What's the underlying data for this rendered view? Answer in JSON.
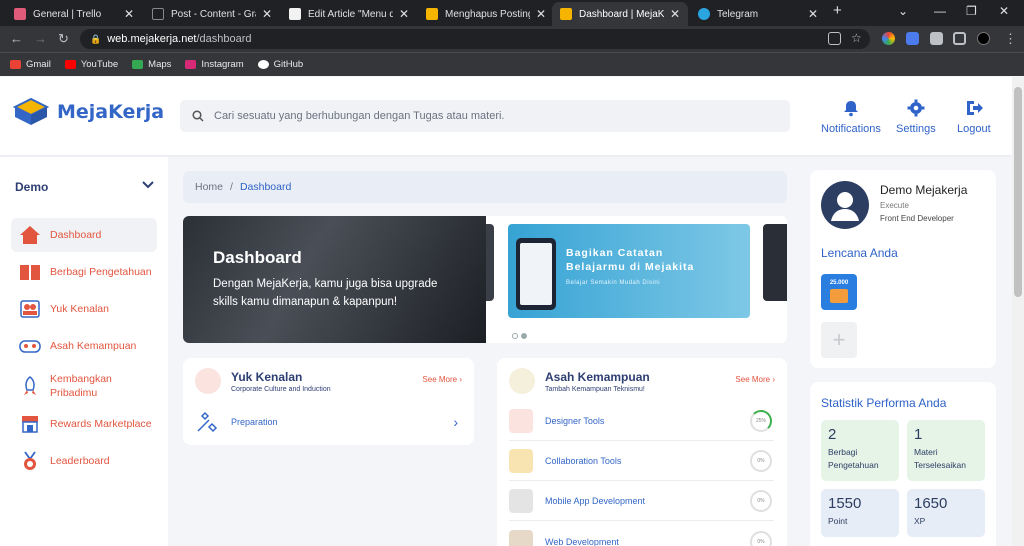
{
  "browser": {
    "tabs": [
      {
        "title": "General | Trello",
        "color": "#e05a7a"
      },
      {
        "title": "Post - Content - Graph",
        "color": "#1d1f22"
      },
      {
        "title": "Edit Article \"Menu da",
        "color": "#f2f2f2"
      },
      {
        "title": "Menghapus Postingan",
        "color": "#f4b400"
      },
      {
        "title": "Dashboard | MejaKerja",
        "color": "#f4b400"
      },
      {
        "title": "Telegram",
        "color": "#2aa5e0"
      }
    ],
    "url_host": "web.mejakerja.net",
    "url_path": "/dashboard",
    "bookmarks": [
      {
        "label": "Gmail",
        "color": "#ea4335"
      },
      {
        "label": "YouTube",
        "color": "#ff0000"
      },
      {
        "label": "Maps",
        "color": "#34a853"
      },
      {
        "label": "Instagram",
        "color": "#d62976"
      },
      {
        "label": "GitHub",
        "color": "#ffffff"
      }
    ]
  },
  "header": {
    "logo": "MejaKerja",
    "search_placeholder": "Cari sesuatu yang berhubungan dengan Tugas atau materi.",
    "notifications": "Notifications",
    "settings": "Settings",
    "logout": "Logout"
  },
  "sidebar": {
    "section": "Demo",
    "items": [
      {
        "label": "Dashboard",
        "icon": "home-icon"
      },
      {
        "label": "Berbagi Pengetahuan",
        "icon": "book-icon"
      },
      {
        "label": "Yuk Kenalan",
        "icon": "people-icon"
      },
      {
        "label": "Asah Kemampuan",
        "icon": "gamepad-icon"
      },
      {
        "label": "Kembangkan Pribadimu",
        "icon": "rocket-icon"
      },
      {
        "label": "Rewards Marketplace",
        "icon": "store-icon"
      },
      {
        "label": "Leaderboard",
        "icon": "medal-icon"
      }
    ]
  },
  "breadcrumb": {
    "home": "Home",
    "current": "Dashboard"
  },
  "hero": {
    "title": "Dashboard",
    "subtitle": "Dengan MejaKerja, kamu juga bisa upgrade skills kamu dimanapun & kapanpun!"
  },
  "slide": {
    "title_line1": "Bagikan Catatan",
    "title_line2": "Belajarmu di Mejakita",
    "subtitle": "Belajar Semakin Mudah Disini"
  },
  "yuk_kenalan": {
    "title": "Yuk Kenalan",
    "subtitle": "Corporate Culture and Induction",
    "see_more": "See More",
    "rows": [
      {
        "label": "Preparation"
      }
    ]
  },
  "asah": {
    "title": "Asah Kemampuan",
    "subtitle": "Tambah Kemampuan Teknismu!",
    "see_more": "See More",
    "rows": [
      {
        "label": "Designer Tools",
        "progress": "25%"
      },
      {
        "label": "Collaboration Tools",
        "progress": "0%"
      },
      {
        "label": "Mobile App Development",
        "progress": "0%"
      },
      {
        "label": "Web Development",
        "progress": "0%"
      }
    ]
  },
  "profile": {
    "name": "Demo Mejakerja",
    "role": "Execute",
    "job": "Front End Developer",
    "lencana_title": "Lencana Anda",
    "badge_text": "25.000",
    "add_symbol": "+"
  },
  "stats": {
    "title": "Statistik Performa Anda",
    "items": [
      {
        "value": "2",
        "label": "Berbagi Pengetahuan"
      },
      {
        "value": "1",
        "label": "Materi Terselesaikan"
      },
      {
        "value": "1550",
        "label": "Point"
      },
      {
        "value": "1650",
        "label": "XP"
      }
    ]
  }
}
